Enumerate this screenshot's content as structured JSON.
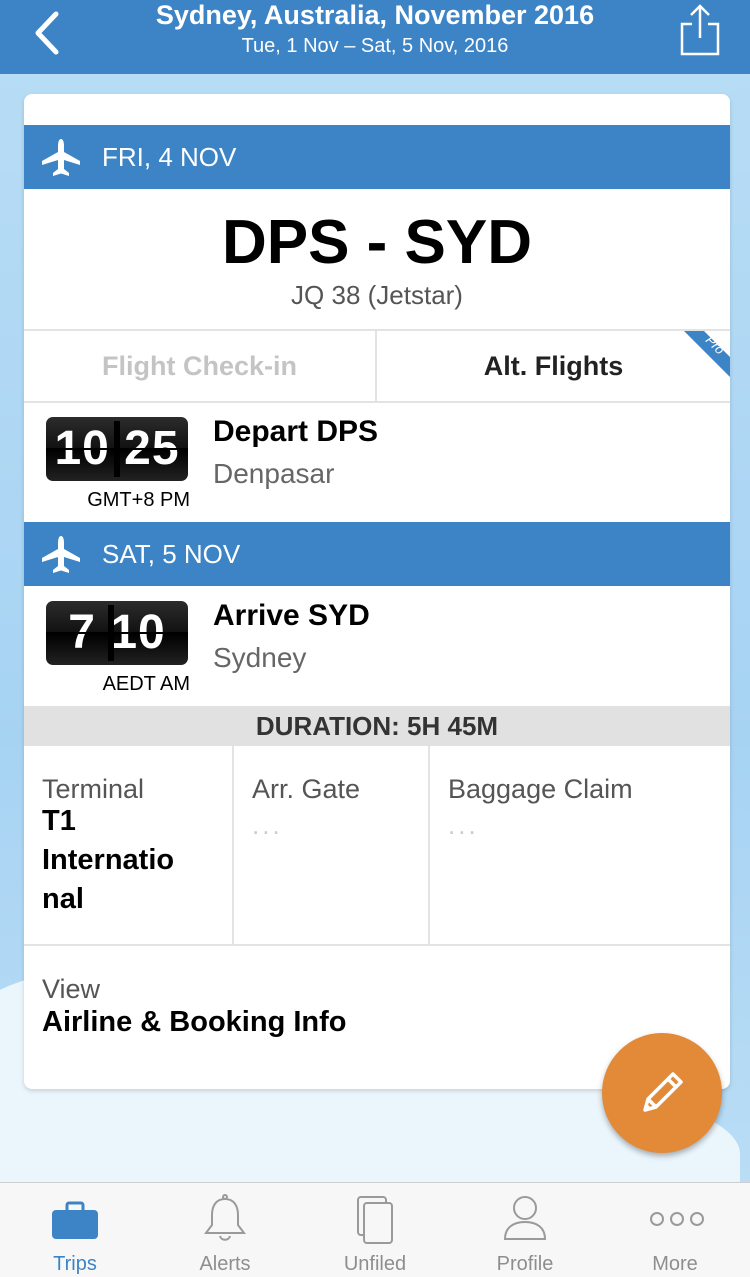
{
  "header": {
    "title": "Sydney, Australia, November 2016",
    "subtitle": "Tue, 1 Nov – Sat, 5 Nov, 2016",
    "back_icon": "chevron-left-icon",
    "share_icon": "share-icon"
  },
  "flight": {
    "departure_day": "FRI, 4 NOV",
    "route": "DPS - SYD",
    "flight_number": "JQ 38 (Jetstar)",
    "actions": {
      "checkin": "Flight Check-in",
      "alt_flights": "Alt. Flights",
      "pro_badge": "Pro"
    },
    "depart": {
      "hour": "10",
      "minute": "25",
      "timezone": "GMT+8 PM",
      "title": "Depart DPS",
      "city": "Denpasar"
    },
    "arrival_day": "SAT, 5 NOV",
    "arrive": {
      "hour": "7",
      "minute": "10",
      "timezone": "AEDT AM",
      "title": "Arrive SYD",
      "city": "Sydney"
    },
    "duration": "DURATION: 5H 45M",
    "details": {
      "terminal_label": "Terminal",
      "terminal_value_line1": "T1",
      "terminal_value_line2": "Internatio",
      "terminal_value_line3": "nal",
      "gate_label": "Arr. Gate",
      "gate_value": "...",
      "baggage_label": "Baggage Claim",
      "baggage_value": "..."
    },
    "view_label": "View",
    "view_link": "Airline & Booking Info"
  },
  "fab": {
    "icon": "pencil-icon"
  },
  "tabbar": [
    {
      "label": "Trips",
      "icon": "briefcase-icon",
      "active": true
    },
    {
      "label": "Alerts",
      "icon": "bell-icon",
      "active": false
    },
    {
      "label": "Unfiled",
      "icon": "documents-icon",
      "active": false
    },
    {
      "label": "Profile",
      "icon": "person-icon",
      "active": false
    },
    {
      "label": "More",
      "icon": "more-dots-icon",
      "active": false
    }
  ],
  "colors": {
    "header_blue": "#3d84c6",
    "fab_orange": "#e28a38",
    "sky": "#a8d4f2"
  }
}
